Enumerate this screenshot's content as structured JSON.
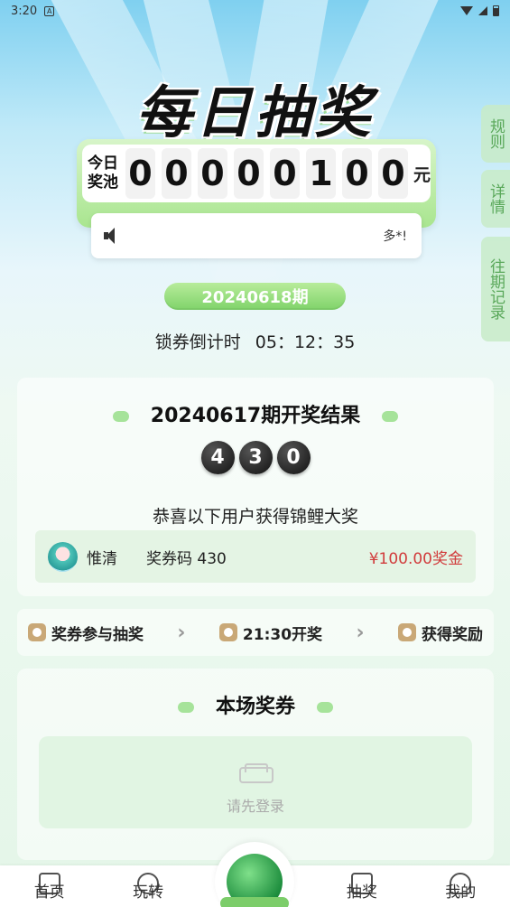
{
  "status_bar": {
    "time": "3:20",
    "notif_glyph": "A"
  },
  "title": "每日抽奖",
  "side_tabs": [
    {
      "label": "规则"
    },
    {
      "label": "详情"
    },
    {
      "label": "往期记录"
    }
  ],
  "pool": {
    "label_line1": "今日",
    "label_line2": "奖池",
    "digits": [
      "0",
      "0",
      "0",
      "0",
      "0",
      "1",
      "0",
      "0"
    ],
    "unit": "元"
  },
  "notice": {
    "text": "多*!"
  },
  "period": "20240618期",
  "countdown": {
    "label": "锁券倒计时",
    "time": "05：12：35"
  },
  "last_result": {
    "title": "20240617期开奖结果",
    "balls": [
      "4",
      "3",
      "0"
    ],
    "congrats": "恭喜以下用户获得锦鲤大奖",
    "winner": {
      "name": "惟清",
      "code": "奖券码 430",
      "prize": "¥100.00奖金"
    }
  },
  "steps": [
    {
      "label": "奖券参与抽奖",
      "icon": "ticket-icon"
    },
    {
      "label": "21:30开奖",
      "icon": "calendar-icon"
    },
    {
      "label": "获得奖励",
      "icon": "money-bag-icon"
    }
  ],
  "tickets": {
    "title": "本场奖券",
    "empty_text": "请先登录"
  },
  "bottom_nav": [
    {
      "label": "首页"
    },
    {
      "label": "玩转"
    },
    {
      "label": "抽奖"
    },
    {
      "label": "我的"
    }
  ]
}
